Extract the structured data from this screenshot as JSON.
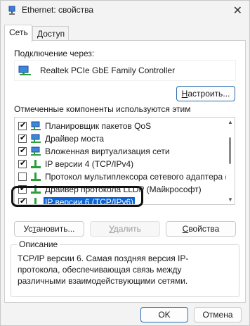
{
  "window": {
    "title": "Ethernet: свойства",
    "close_glyph": "✕"
  },
  "tabs": [
    {
      "label": "Сеть",
      "active": true
    },
    {
      "label": "Доступ",
      "active": false
    }
  ],
  "connect_using_label": "Подключение через:",
  "adapter_name": "Realtek PCIe GbE Family Controller",
  "configure_button": {
    "prefix": "",
    "accel": "Н",
    "rest": "астроить..."
  },
  "components_label": "Отмеченные компоненты используются этим подключением:",
  "components": [
    {
      "label": "Планировщик пакетов QoS",
      "checked": true,
      "icon": "network-service-icon"
    },
    {
      "label": "Драйвер моста",
      "checked": true,
      "icon": "network-service-icon"
    },
    {
      "label": "Вложенная виртуализация сети",
      "checked": true,
      "icon": "network-service-icon"
    },
    {
      "label": "IP версии 4 (TCP/IPv4)",
      "checked": true,
      "icon": "protocol-icon"
    },
    {
      "label": "Протокол мультиплексора сетевого адаптера (Май",
      "checked": false,
      "icon": "protocol-icon"
    },
    {
      "label": "Драйвер протокола LLDP (Майкрософт)",
      "checked": true,
      "icon": "protocol-icon"
    },
    {
      "label": "IP версии 6 (TCP/IPv6)",
      "checked": true,
      "icon": "protocol-icon",
      "selected": true
    }
  ],
  "buttons": {
    "install": {
      "prefix": "Ус",
      "accel": "т",
      "rest": "ановить..."
    },
    "uninstall": {
      "prefix": "",
      "accel": "У",
      "rest": "далить"
    },
    "properties": {
      "prefix": "",
      "accel": "С",
      "rest": "войства"
    },
    "ok": "OK",
    "cancel": "Отмена"
  },
  "description": {
    "title": "Описание",
    "text": "TCP/IP версии 6. Самая поздняя версия IP-протокола, обеспечивающая связь между различными взаимодействующими сетями."
  },
  "colors": {
    "accent": "#0a64d6",
    "highlight_border": "#111111",
    "icon_green": "#2e9e3a",
    "icon_blue": "#2a6fd1"
  }
}
